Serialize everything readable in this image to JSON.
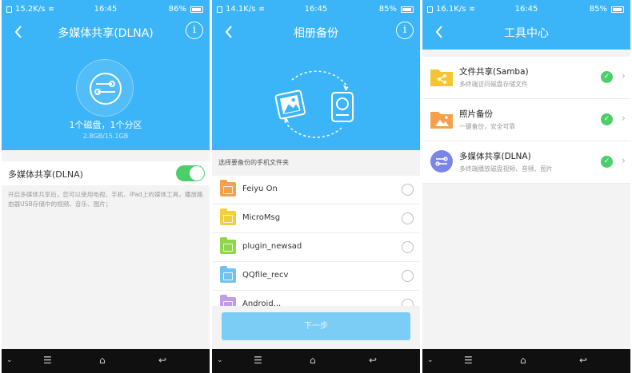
{
  "colors": {
    "primary_blue": "#3cb4f8",
    "toggle_green": "#4cce6b",
    "button_disabled": "#7ccdf6"
  },
  "panels": [
    {
      "status": {
        "speed": "15.2K/s",
        "time": "16:45",
        "battery": "86%"
      },
      "title": "多媒体共享(DLNA)",
      "disk_info": "1个磁盘，1个分区",
      "disk_size": "2.8GB/15.1GB",
      "toggle_label": "多媒体共享(DLNA)",
      "toggle_on": true,
      "description": "开启多媒体共享后，您可以使用电视、手机、iPad上的媒体工具，播放路由器USB存储中的视频、音乐、图片；"
    },
    {
      "status": {
        "speed": "14.1K/s",
        "time": "16:45",
        "battery": "85%"
      },
      "title": "相册备份",
      "section_label": "选择要备份的手机文件夹",
      "folders": [
        {
          "name": "Feiyu On",
          "color": "#f5a04a"
        },
        {
          "name": "MicroMsg",
          "color": "#f2cf3c"
        },
        {
          "name": "plugin_newsad",
          "color": "#8fd64a"
        },
        {
          "name": "QQfile_recv",
          "color": "#72c2ef"
        },
        {
          "name": "Android...",
          "color": "#c29bed"
        }
      ],
      "next_button": "下一步"
    },
    {
      "status": {
        "speed": "16.1K/s",
        "time": "16:45",
        "battery": "85%"
      },
      "title": "工具中心",
      "tools": [
        {
          "title": "文件共享(Samba)",
          "subtitle": "多终端访问磁盘存储文件",
          "icon": "share-folder-icon"
        },
        {
          "title": "照片备份",
          "subtitle": "一键备份，安全可靠",
          "icon": "photo-folder-icon"
        },
        {
          "title": "多媒体共享(DLNA)",
          "subtitle": "多终端播放磁盘视频、音频、图片",
          "icon": "dlna-icon"
        }
      ]
    }
  ],
  "navbar": {
    "down_icon": "chevron-down-icon",
    "menu_icon": "menu-icon",
    "home_icon": "home-icon",
    "back_icon": "back-arrow-icon"
  }
}
